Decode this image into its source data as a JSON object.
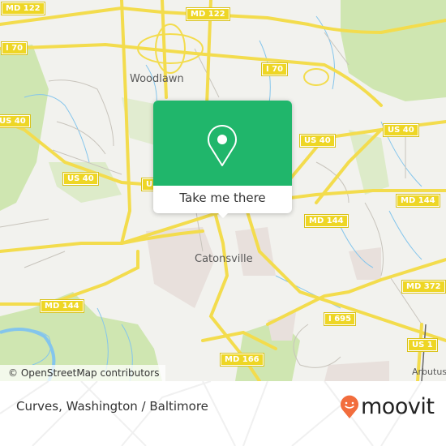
{
  "map": {
    "road_shields": [
      {
        "label": "MD 122",
        "id": "md122-west"
      },
      {
        "label": "MD 122",
        "id": "md122-north"
      },
      {
        "label": "I 70",
        "id": "i70-west"
      },
      {
        "label": "I 70",
        "id": "i70-east"
      },
      {
        "label": "US 40",
        "id": "us40-west-edge"
      },
      {
        "label": "US 40",
        "id": "us40-west"
      },
      {
        "label": "US 40",
        "id": "us40-center"
      },
      {
        "label": "US 40",
        "id": "us40-east"
      },
      {
        "label": "MD 144",
        "id": "md144-east"
      },
      {
        "label": "MD 144",
        "id": "md144-center"
      },
      {
        "label": "MD 144",
        "id": "md144-west"
      },
      {
        "label": "MD 372",
        "id": "md372"
      },
      {
        "label": "I 695",
        "id": "i695"
      },
      {
        "label": "US 1",
        "id": "us1"
      },
      {
        "label": "MD 166",
        "id": "md166"
      }
    ],
    "places": {
      "woodlawn": "Woodlawn",
      "catonsville": "Catonsville",
      "arbutus": "Arbutus"
    },
    "colors": {
      "background": "#f2f2ee",
      "park": "#cfe6b1",
      "road": "#f3dc4d",
      "water": "#84c5ec",
      "urban": "#e8e0dc"
    }
  },
  "popup": {
    "icon": "location-pin-icon",
    "button_label": "Take me there",
    "accent_color": "#20b66b"
  },
  "attribution": "© OpenStreetMap contributors",
  "footer": {
    "caption": "Curves, Washington / Baltimore",
    "brand": "moovit",
    "brand_color": "#f26d3d"
  }
}
